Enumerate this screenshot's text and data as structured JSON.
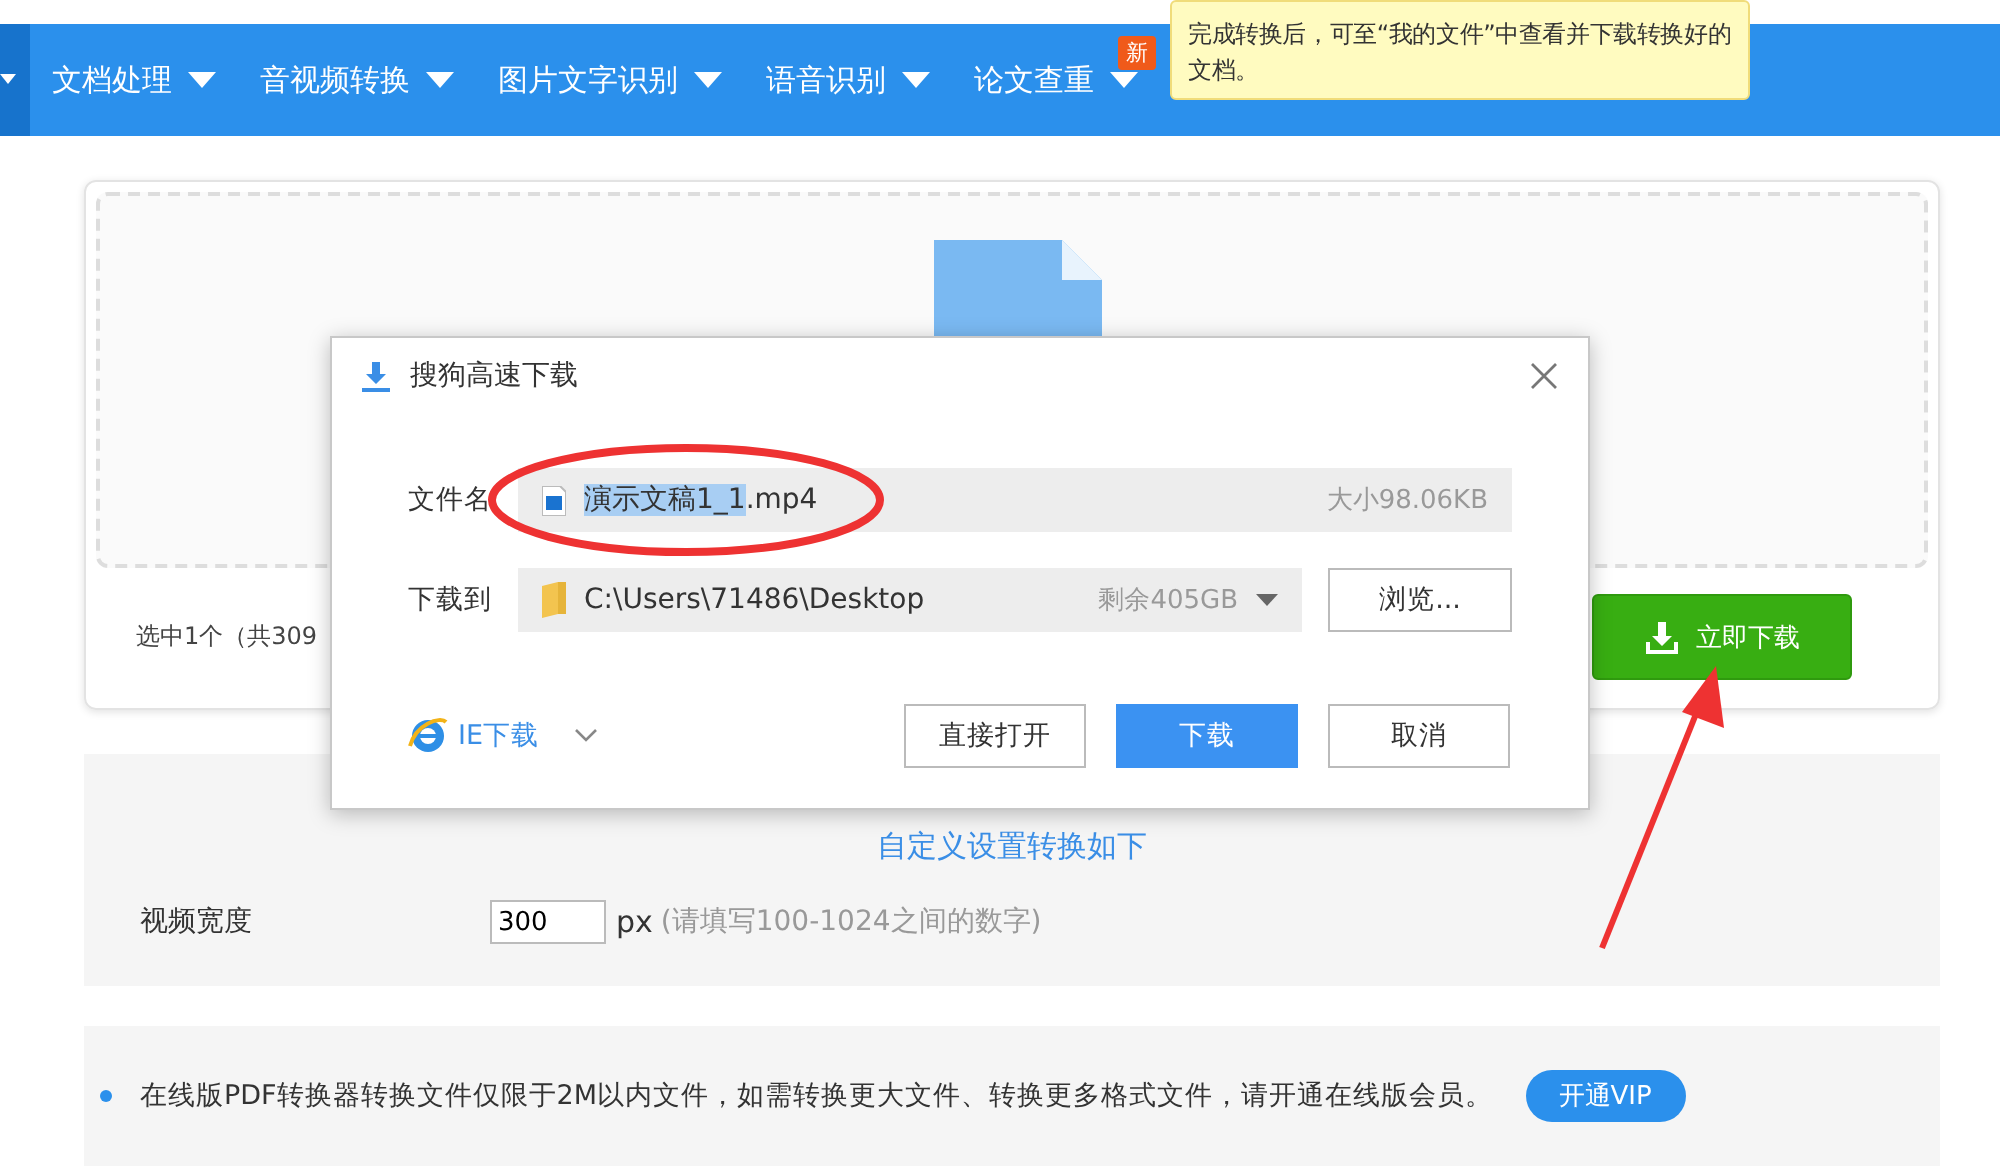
{
  "nav": {
    "items": [
      {
        "label": "文档处理"
      },
      {
        "label": "音视频转换"
      },
      {
        "label": "图片文字识别"
      },
      {
        "label": "语音识别"
      },
      {
        "label": "论文查重",
        "new_badge": "新"
      }
    ]
  },
  "tooltip": {
    "text": "完成转换后，可至“我的文件”中查看并下载转换好的文档。"
  },
  "upload_card": {
    "selection_text": "选中1个（共309",
    "download_button": "立即下载"
  },
  "dialog": {
    "title": "搜狗高速下载",
    "file_name_label": "文件名",
    "file_name_parts": [
      {
        "text": "演示文稿1_1",
        "selected": true
      },
      {
        "text": ".mp4",
        "selected": false
      }
    ],
    "file_size": "大小98.06KB",
    "save_to_label": "下载到",
    "save_path": "C:\\Users\\71486\\Desktop",
    "free_space": "剩余405GB",
    "browse_button": "浏览...",
    "downloader": "IE下载",
    "buttons": [
      {
        "label": "直接打开",
        "primary": false
      },
      {
        "label": "下载",
        "primary": true
      },
      {
        "label": "取消",
        "primary": false
      }
    ]
  },
  "settings": {
    "title": "自定义设置转换如下",
    "width_label": "视频宽度",
    "width_value": "300",
    "unit": "px",
    "hint": "(请填写100-1024之间的数字)"
  },
  "notice": {
    "text": "在线版PDF转换器转换文件仅限于2M以内文件，如需转换更大文件、转换更多格式文件，请开通在线版会员。",
    "vip_button": "开通VIP"
  }
}
